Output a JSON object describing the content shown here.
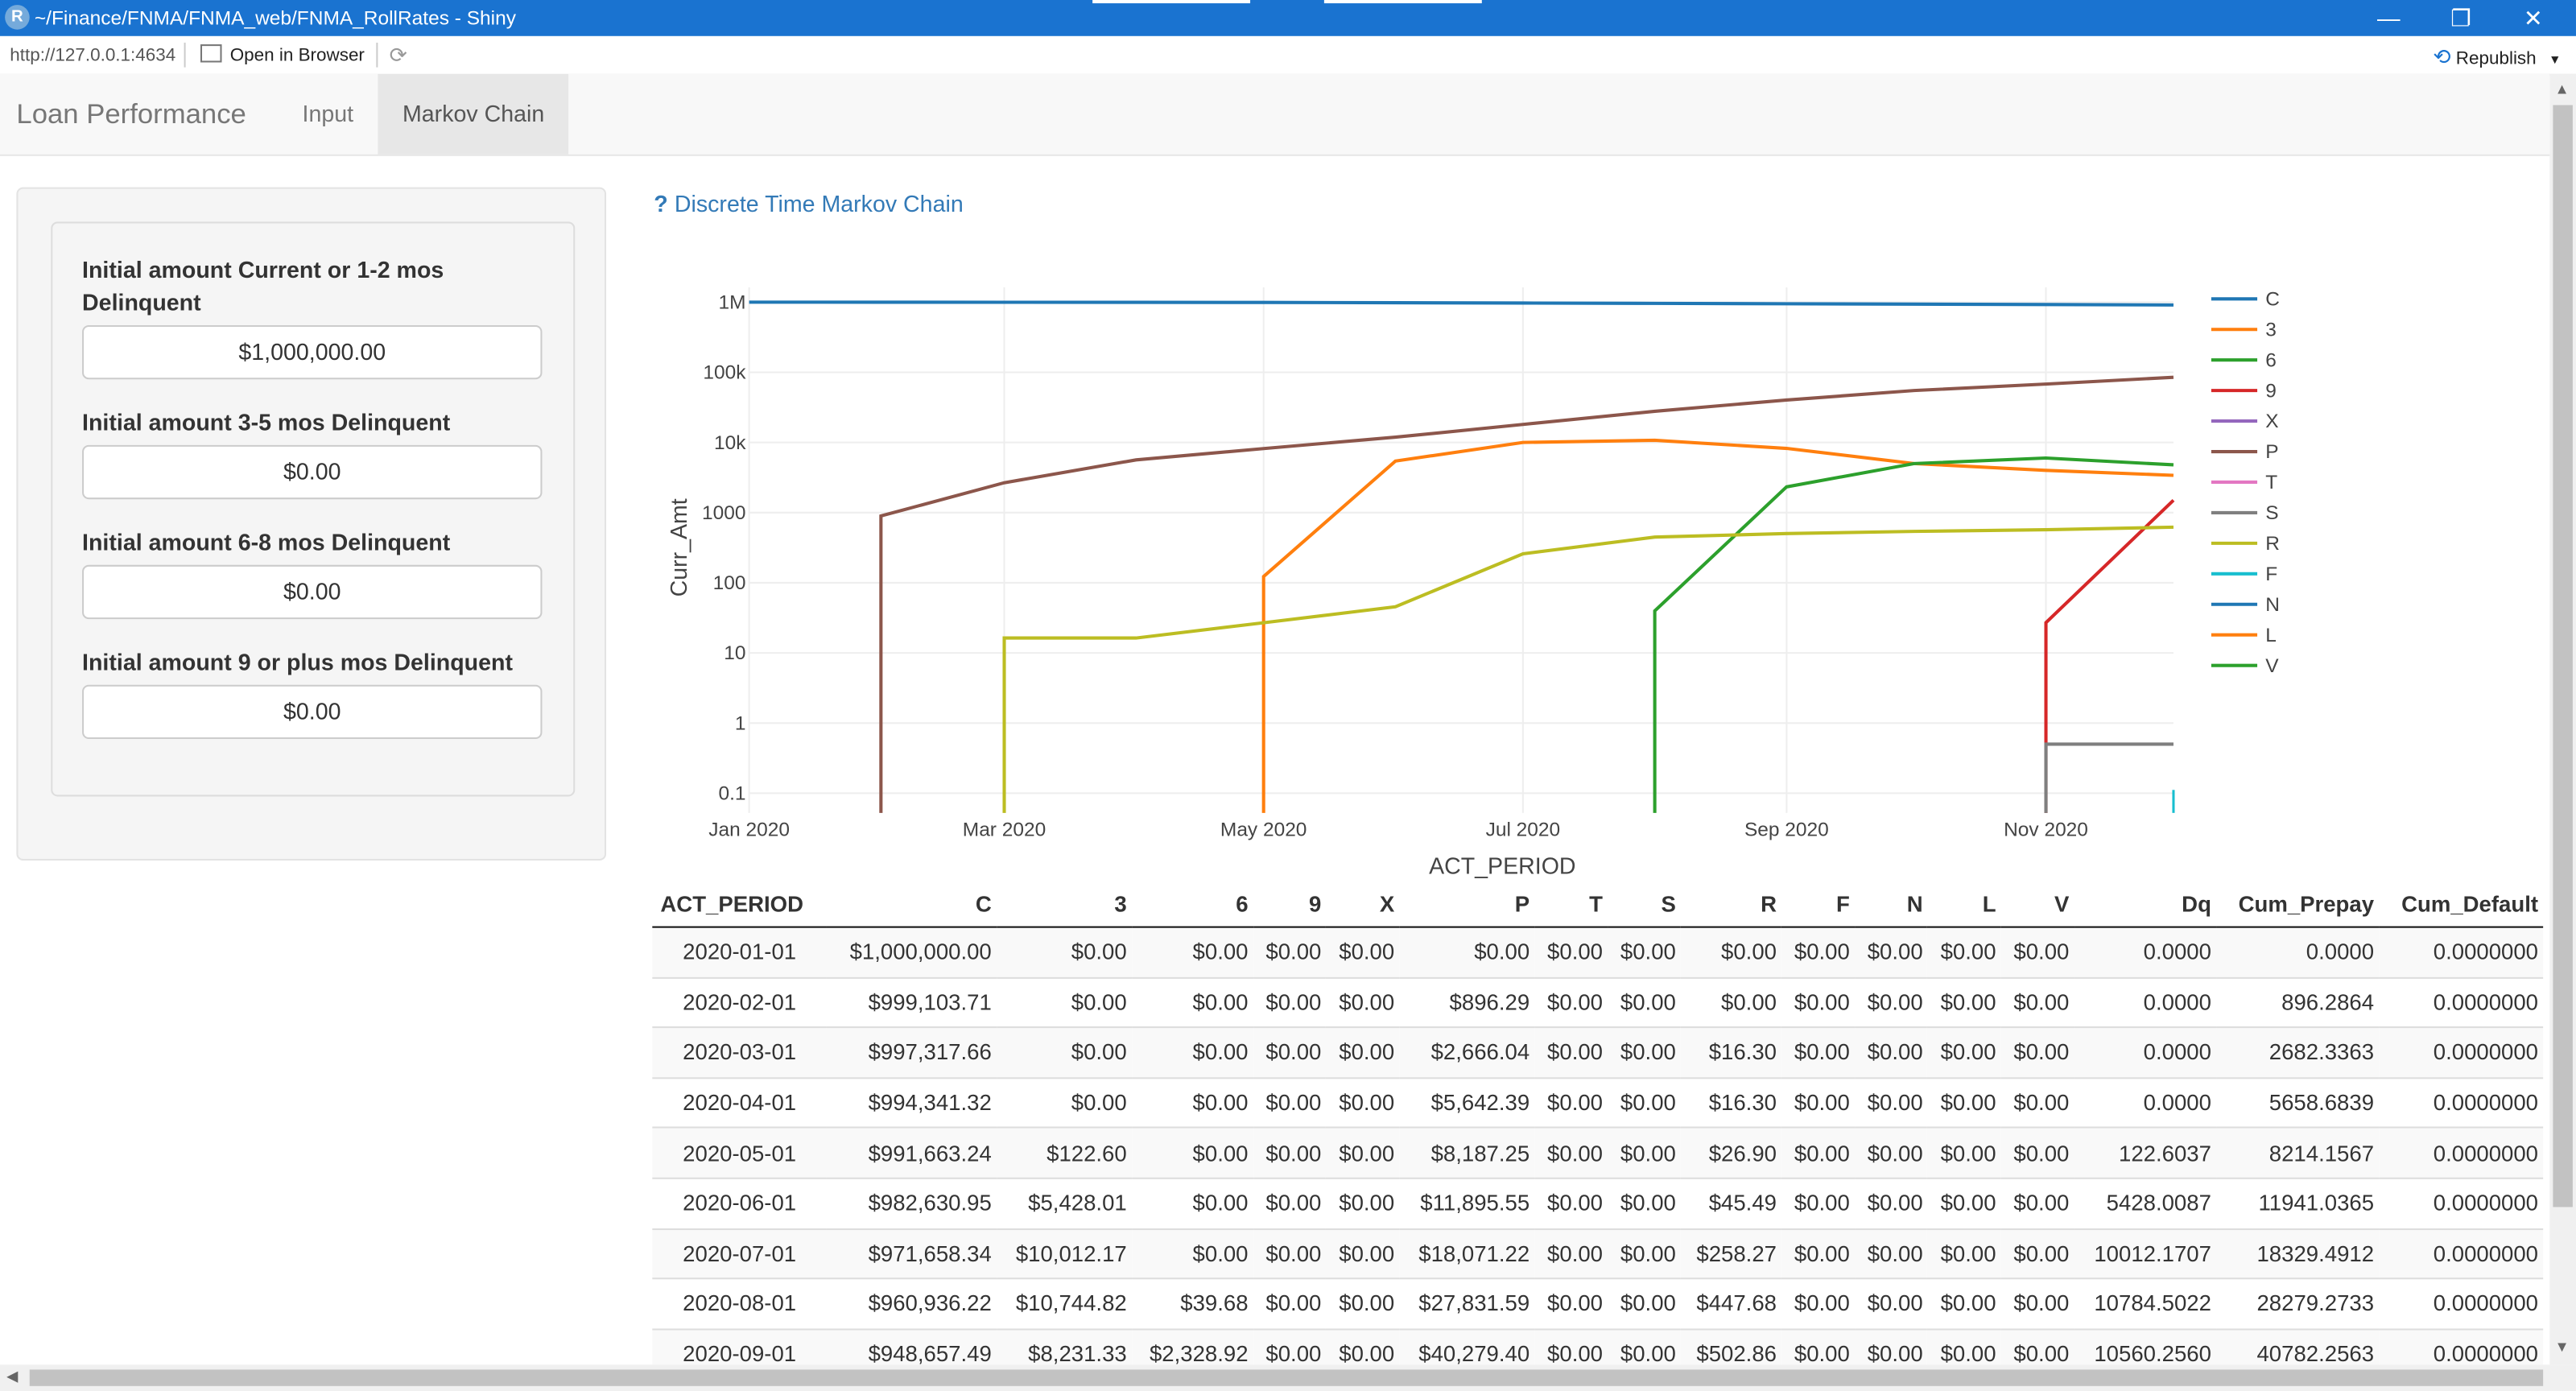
{
  "window": {
    "title": "~/Finance/FNMA/FNMA_web/FNMA_RollRates - Shiny",
    "r_logo": "R",
    "buttons": {
      "minimize": "—",
      "restore": "❐",
      "close": "✕"
    }
  },
  "addressbar": {
    "url": "http://127.0.0.1:4634",
    "open_in_browser": "Open in Browser",
    "republish": "Republish",
    "republish_caret": "▾"
  },
  "navbar": {
    "brand": "Loan Performance",
    "tabs": [
      {
        "label": "Input"
      },
      {
        "label": "Markov Chain",
        "active": true
      }
    ]
  },
  "sidebar": {
    "fields": [
      {
        "label": "Initial amount Current or 1-2 mos Delinquent",
        "value": "$1,000,000.00"
      },
      {
        "label": "Initial amount 3-5 mos Delinquent",
        "value": "$0.00"
      },
      {
        "label": "Initial amount 6-8 mos Delinquent",
        "value": "$0.00"
      },
      {
        "label": "Initial amount 9 or plus mos Delinquent",
        "value": "$0.00"
      }
    ]
  },
  "help_link": {
    "icon": "?",
    "text": "Discrete Time Markov Chain"
  },
  "colors": {
    "titlebar": "#1a73d0",
    "link": "#337ab7"
  },
  "chart_data": {
    "type": "line",
    "xlabel": "ACT_PERIOD",
    "ylabel": "Curr_Amt",
    "log_y": true,
    "grid": true,
    "legend_placement": "right",
    "x_ticks": [
      "Jan 2020",
      "Mar 2020",
      "May 2020",
      "Jul 2020",
      "Sep 2020",
      "Nov 2020"
    ],
    "y_ticks": [
      "0.1",
      "1",
      "10",
      "100",
      "1000",
      "10k",
      "100k",
      "1M"
    ],
    "x_dates": [
      "2020-01-01",
      "2020-02-01",
      "2020-03-01",
      "2020-04-01",
      "2020-05-01",
      "2020-06-01",
      "2020-07-01",
      "2020-08-01",
      "2020-09-01",
      "2020-10-01",
      "2020-11-01",
      "2020-12-01"
    ],
    "series": [
      {
        "name": "C",
        "color": "#1f77b4",
        "values": [
          1000000,
          999103.71,
          997317.66,
          994341.32,
          991663.24,
          982630.95,
          971658.34,
          960936.22,
          948657.49,
          938000,
          925000,
          912000
        ]
      },
      {
        "name": "3",
        "color": "#ff7f0e",
        "values": [
          0,
          0,
          0,
          0,
          122.6,
          5428.01,
          10012.17,
          10744.82,
          8231.33,
          5000,
          4000,
          3400
        ]
      },
      {
        "name": "6",
        "color": "#2ca02c",
        "values": [
          0,
          0,
          0,
          0,
          0,
          0,
          0,
          39.68,
          2328.92,
          5000,
          6000,
          4800
        ]
      },
      {
        "name": "9",
        "color": "#d62728",
        "values": [
          0,
          0,
          0,
          0,
          0,
          0,
          0,
          0,
          0,
          0,
          27,
          1500
        ]
      },
      {
        "name": "X",
        "color": "#9467bd",
        "values": [
          0,
          0,
          0,
          0,
          0,
          0,
          0,
          0,
          0,
          0,
          0,
          0
        ]
      },
      {
        "name": "P",
        "color": "#8c564b",
        "values": [
          0,
          896.29,
          2666.04,
          5642.39,
          8187.25,
          11895.55,
          18071.22,
          27831.59,
          40279.4,
          55000,
          68000,
          85000
        ]
      },
      {
        "name": "T",
        "color": "#e377c2",
        "values": [
          0,
          0,
          0,
          0,
          0,
          0,
          0,
          0,
          0,
          0,
          0,
          0
        ]
      },
      {
        "name": "S",
        "color": "#7f7f7f",
        "values": [
          0,
          0,
          0,
          0,
          0,
          0,
          0,
          0,
          0,
          0,
          0.5,
          0.5
        ]
      },
      {
        "name": "R",
        "color": "#bcbd22",
        "values": [
          0,
          0,
          16.3,
          16.3,
          26.9,
          45.49,
          258.27,
          447.68,
          502.86,
          540,
          570,
          620
        ]
      },
      {
        "name": "F",
        "color": "#17becf",
        "values": [
          0,
          0,
          0,
          0,
          0,
          0,
          0,
          0,
          0,
          0,
          0,
          0
        ]
      },
      {
        "name": "N",
        "color": "#1f77b4",
        "values": [
          0,
          0,
          0,
          0,
          0,
          0,
          0,
          0,
          0,
          0,
          0,
          0
        ]
      },
      {
        "name": "L",
        "color": "#ff7f0e",
        "values": [
          0,
          0,
          0,
          0,
          0,
          0,
          0,
          0,
          0,
          0,
          0,
          0
        ]
      },
      {
        "name": "V",
        "color": "#2ca02c",
        "values": [
          0,
          0,
          0,
          0,
          0,
          0,
          0,
          0,
          0,
          0,
          0,
          0
        ]
      }
    ]
  },
  "table": {
    "headers": [
      "ACT_PERIOD",
      "C",
      "3",
      "6",
      "9",
      "X",
      "P",
      "T",
      "S",
      "R",
      "F",
      "N",
      "L",
      "V",
      "Dq",
      "Cum_Prepay",
      "Cum_Default"
    ],
    "rows": [
      [
        "2020-01-01",
        "$1,000,000.00",
        "$0.00",
        "$0.00",
        "$0.00",
        "$0.00",
        "$0.00",
        "$0.00",
        "$0.00",
        "$0.00",
        "$0.00",
        "$0.00",
        "$0.00",
        "$0.00",
        "0.0000",
        "0.0000",
        "0.0000000"
      ],
      [
        "2020-02-01",
        "$999,103.71",
        "$0.00",
        "$0.00",
        "$0.00",
        "$0.00",
        "$896.29",
        "$0.00",
        "$0.00",
        "$0.00",
        "$0.00",
        "$0.00",
        "$0.00",
        "$0.00",
        "0.0000",
        "896.2864",
        "0.0000000"
      ],
      [
        "2020-03-01",
        "$997,317.66",
        "$0.00",
        "$0.00",
        "$0.00",
        "$0.00",
        "$2,666.04",
        "$0.00",
        "$0.00",
        "$16.30",
        "$0.00",
        "$0.00",
        "$0.00",
        "$0.00",
        "0.0000",
        "2682.3363",
        "0.0000000"
      ],
      [
        "2020-04-01",
        "$994,341.32",
        "$0.00",
        "$0.00",
        "$0.00",
        "$0.00",
        "$5,642.39",
        "$0.00",
        "$0.00",
        "$16.30",
        "$0.00",
        "$0.00",
        "$0.00",
        "$0.00",
        "0.0000",
        "5658.6839",
        "0.0000000"
      ],
      [
        "2020-05-01",
        "$991,663.24",
        "$122.60",
        "$0.00",
        "$0.00",
        "$0.00",
        "$8,187.25",
        "$0.00",
        "$0.00",
        "$26.90",
        "$0.00",
        "$0.00",
        "$0.00",
        "$0.00",
        "122.6037",
        "8214.1567",
        "0.0000000"
      ],
      [
        "2020-06-01",
        "$982,630.95",
        "$5,428.01",
        "$0.00",
        "$0.00",
        "$0.00",
        "$11,895.55",
        "$0.00",
        "$0.00",
        "$45.49",
        "$0.00",
        "$0.00",
        "$0.00",
        "$0.00",
        "5428.0087",
        "11941.0365",
        "0.0000000"
      ],
      [
        "2020-07-01",
        "$971,658.34",
        "$10,012.17",
        "$0.00",
        "$0.00",
        "$0.00",
        "$18,071.22",
        "$0.00",
        "$0.00",
        "$258.27",
        "$0.00",
        "$0.00",
        "$0.00",
        "$0.00",
        "10012.1707",
        "18329.4912",
        "0.0000000"
      ],
      [
        "2020-08-01",
        "$960,936.22",
        "$10,744.82",
        "$39.68",
        "$0.00",
        "$0.00",
        "$27,831.59",
        "$0.00",
        "$0.00",
        "$447.68",
        "$0.00",
        "$0.00",
        "$0.00",
        "$0.00",
        "10784.5022",
        "28279.2733",
        "0.0000000"
      ],
      [
        "2020-09-01",
        "$948,657.49",
        "$8,231.33",
        "$2,328.92",
        "$0.00",
        "$0.00",
        "$40,279.40",
        "$0.00",
        "$0.00",
        "$502.86",
        "$0.00",
        "$0.00",
        "$0.00",
        "$0.00",
        "10560.2560",
        "40782.2563",
        "0.0000000"
      ]
    ]
  }
}
